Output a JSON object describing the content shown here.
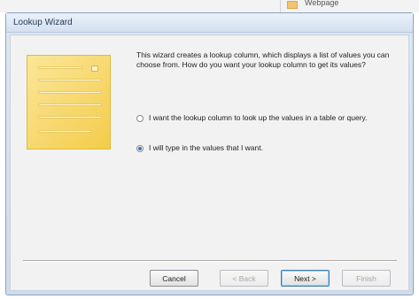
{
  "background": {
    "cell_text": "Webpage"
  },
  "dialog": {
    "title": "Lookup Wizard",
    "description": "This wizard creates a lookup column, which displays a list of values you can choose from.  How do you want your lookup column to get its values?",
    "options": [
      {
        "label": "I want the lookup column to look up the values in a table or query.",
        "selected": false
      },
      {
        "label": "I will type in the values that I want.",
        "selected": true
      }
    ],
    "buttons": {
      "cancel": "Cancel",
      "back": "< Back",
      "next": "Next >",
      "finish": "Finish"
    }
  },
  "colors": {
    "illustration": "#f4cc4a",
    "titlebar": "#d4e0ef",
    "radio_selected": "#3a6fc4"
  }
}
